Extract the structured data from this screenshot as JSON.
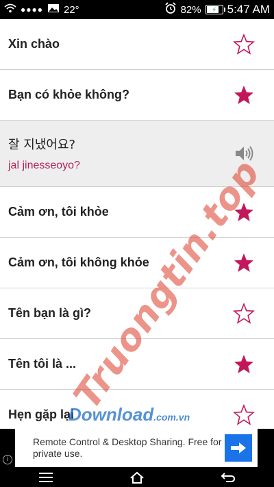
{
  "status_bar": {
    "temperature": "22°",
    "battery": "82%",
    "battery_level": 0.82,
    "time": "5:47 AM",
    "icons": [
      "wifi-icon",
      "signal-dots-icon",
      "image-icon",
      "alarm-clock-icon",
      "battery-charging-icon"
    ]
  },
  "phrases": [
    {
      "text": "Xin chào",
      "favorite": false
    },
    {
      "text": "Bạn có khỏe không?",
      "favorite": true
    },
    {
      "text": "잘 지냈어요?",
      "romanization": "jal jinesseoyo?",
      "expanded": true,
      "icon": "speaker-icon"
    },
    {
      "text": "Cảm ơn, tôi khỏe",
      "favorite": true
    },
    {
      "text": "Cảm ơn, tôi không khỏe",
      "favorite": true
    },
    {
      "text": "Tên bạn là gì?",
      "favorite": false
    },
    {
      "text": "Tên tôi là ...",
      "favorite": true
    },
    {
      "text": "Hẹn gặp lại",
      "favorite": false
    }
  ],
  "colors": {
    "star": "#c2185b",
    "romanization": "#b1245a",
    "ad_button": "#1a73e8"
  },
  "ad": {
    "text": "Remote Control & Desktop Sharing. Free for private use.",
    "button_icon": "arrow-right-icon",
    "info_icon": "info-icon",
    "info_glyph": "i"
  },
  "nav": {
    "icons": [
      "menu-icon",
      "home-icon",
      "back-icon"
    ]
  },
  "watermark": {
    "text": "Truongtin.top",
    "brand": "Download",
    "domain": ".com.vn"
  }
}
